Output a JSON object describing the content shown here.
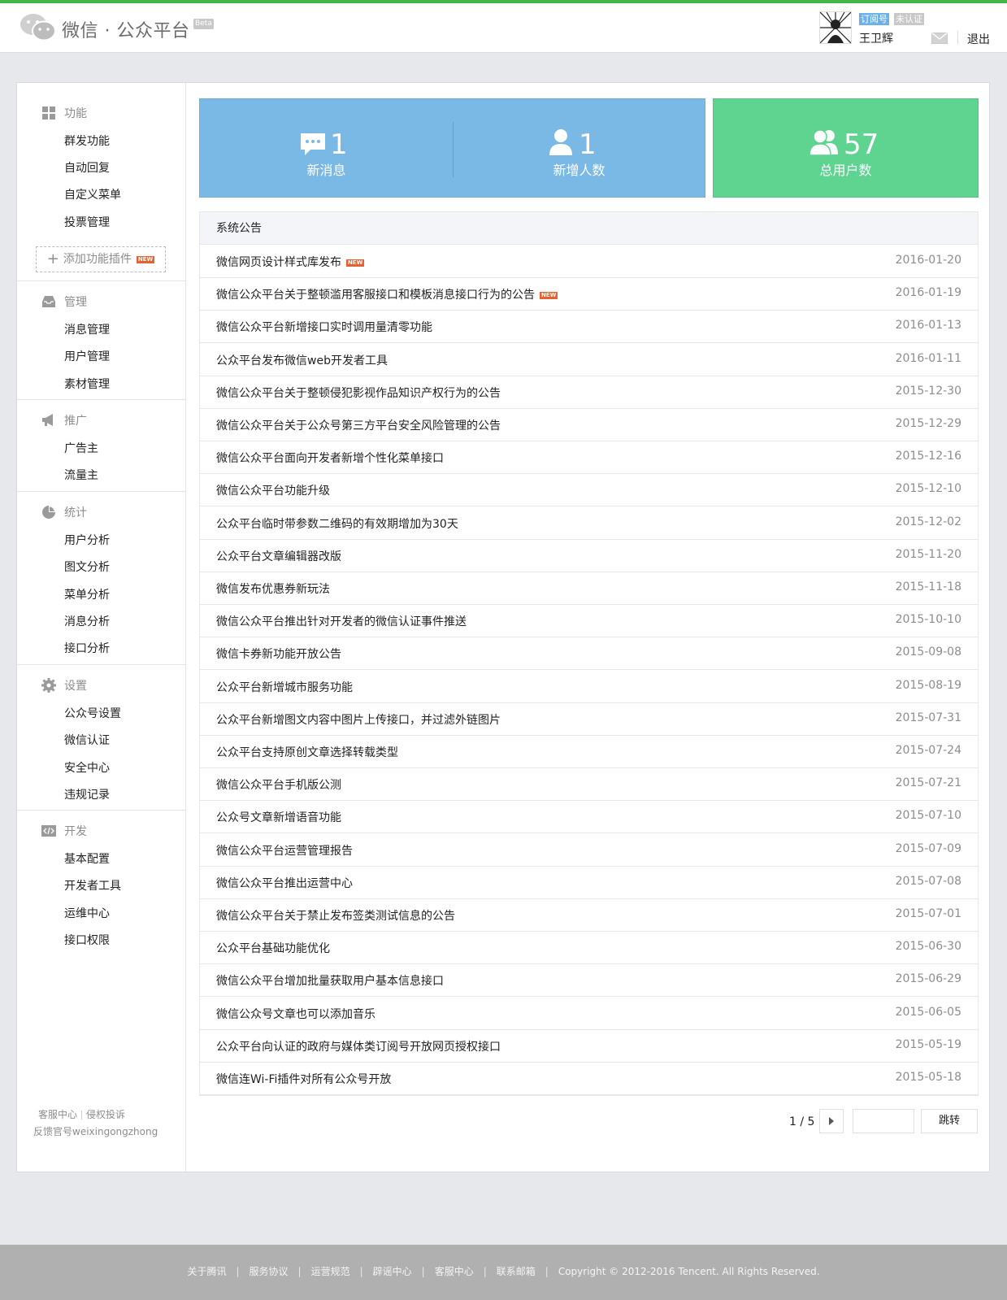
{
  "header": {
    "brand": "微信 · 公众平台",
    "beta": "Beta",
    "account_type": "订阅号",
    "verify_status": "未认证",
    "username": "王卫辉",
    "logout": "退出"
  },
  "sidebar": {
    "sections": [
      {
        "title": "功能",
        "icon": "grid-icon",
        "items": [
          "群发功能",
          "自动回复",
          "自定义菜单",
          "投票管理"
        ]
      },
      {
        "title": "管理",
        "icon": "inbox-icon",
        "items": [
          "消息管理",
          "用户管理",
          "素材管理"
        ]
      },
      {
        "title": "推广",
        "icon": "megaphone-icon",
        "items": [
          "广告主",
          "流量主"
        ]
      },
      {
        "title": "统计",
        "icon": "pie-chart-icon",
        "items": [
          "用户分析",
          "图文分析",
          "菜单分析",
          "消息分析",
          "接口分析"
        ]
      },
      {
        "title": "设置",
        "icon": "gear-icon",
        "items": [
          "公众号设置",
          "微信认证",
          "安全中心",
          "违规记录"
        ]
      },
      {
        "title": "开发",
        "icon": "code-icon",
        "items": [
          "基本配置",
          "开发者工具",
          "运维中心",
          "接口权限"
        ]
      }
    ],
    "add_plugin": "添加功能插件",
    "new_tag": "NEW",
    "footer_link1": "客服中心",
    "footer_link2": "侵权投诉",
    "footer_account": "反馈官号weixingongzhong"
  },
  "stats": {
    "new_messages": {
      "value": "1",
      "label": "新消息"
    },
    "new_followers": {
      "value": "1",
      "label": "新增人数"
    },
    "total_users": {
      "value": "57",
      "label": "总用户数"
    }
  },
  "notices": {
    "title": "系统公告",
    "items": [
      {
        "title": "微信网页设计样式库发布",
        "date": "2016-01-20",
        "new": true
      },
      {
        "title": "微信公众平台关于整顿滥用客服接口和模板消息接口行为的公告",
        "date": "2016-01-19",
        "new": true
      },
      {
        "title": "微信公众平台新增接口实时调用量清零功能",
        "date": "2016-01-13",
        "new": false
      },
      {
        "title": "公众平台发布微信web开发者工具",
        "date": "2016-01-11",
        "new": false
      },
      {
        "title": "微信公众平台关于整顿侵犯影视作品知识产权行为的公告",
        "date": "2015-12-30",
        "new": false
      },
      {
        "title": "微信公众平台关于公众号第三方平台安全风险管理的公告",
        "date": "2015-12-29",
        "new": false
      },
      {
        "title": "微信公众平台面向开发者新增个性化菜单接口",
        "date": "2015-12-16",
        "new": false
      },
      {
        "title": "微信公众平台功能升级",
        "date": "2015-12-10",
        "new": false
      },
      {
        "title": "公众平台临时带参数二维码的有效期增加为30天",
        "date": "2015-12-02",
        "new": false
      },
      {
        "title": "公众平台文章编辑器改版",
        "date": "2015-11-20",
        "new": false
      },
      {
        "title": "微信发布优惠券新玩法",
        "date": "2015-11-18",
        "new": false
      },
      {
        "title": "微信公众平台推出针对开发者的微信认证事件推送",
        "date": "2015-10-10",
        "new": false
      },
      {
        "title": "微信卡券新功能开放公告",
        "date": "2015-09-08",
        "new": false
      },
      {
        "title": "公众平台新增城市服务功能",
        "date": "2015-08-19",
        "new": false
      },
      {
        "title": "公众平台新增图文内容中图片上传接口，并过滤外链图片",
        "date": "2015-07-31",
        "new": false
      },
      {
        "title": "公众平台支持原创文章选择转载类型",
        "date": "2015-07-24",
        "new": false
      },
      {
        "title": "微信公众平台手机版公测",
        "date": "2015-07-21",
        "new": false
      },
      {
        "title": "公众号文章新增语音功能",
        "date": "2015-07-10",
        "new": false
      },
      {
        "title": "微信公众平台运营管理报告",
        "date": "2015-07-09",
        "new": false
      },
      {
        "title": "微信公众平台推出运营中心",
        "date": "2015-07-08",
        "new": false
      },
      {
        "title": "微信公众平台关于禁止发布签类测试信息的公告",
        "date": "2015-07-01",
        "new": false
      },
      {
        "title": "公众平台基础功能优化",
        "date": "2015-06-30",
        "new": false
      },
      {
        "title": "微信公众平台增加批量获取用户基本信息接口",
        "date": "2015-06-29",
        "new": false
      },
      {
        "title": "微信公众号文章也可以添加音乐",
        "date": "2015-06-05",
        "new": false
      },
      {
        "title": "公众平台向认证的政府与媒体类订阅号开放网页授权接口",
        "date": "2015-05-19",
        "new": false
      },
      {
        "title": "微信连Wi-Fi插件对所有公众号开放",
        "date": "2015-05-18",
        "new": false
      }
    ]
  },
  "pagination": {
    "current": "1 / 5",
    "jump_label": "跳转",
    "input_value": ""
  },
  "footer": {
    "links": [
      "关于腾讯",
      "服务协议",
      "运营规范",
      "辟谣中心",
      "客服中心",
      "联系邮箱"
    ],
    "copyright": "Copyright © 2012-2016 Tencent. All Rights Reserved."
  },
  "colors": {
    "brand_green": "#44b549",
    "stat_blue": "#7ab9e5",
    "stat_green": "#5fd390",
    "new_badge": "#e5612f"
  }
}
